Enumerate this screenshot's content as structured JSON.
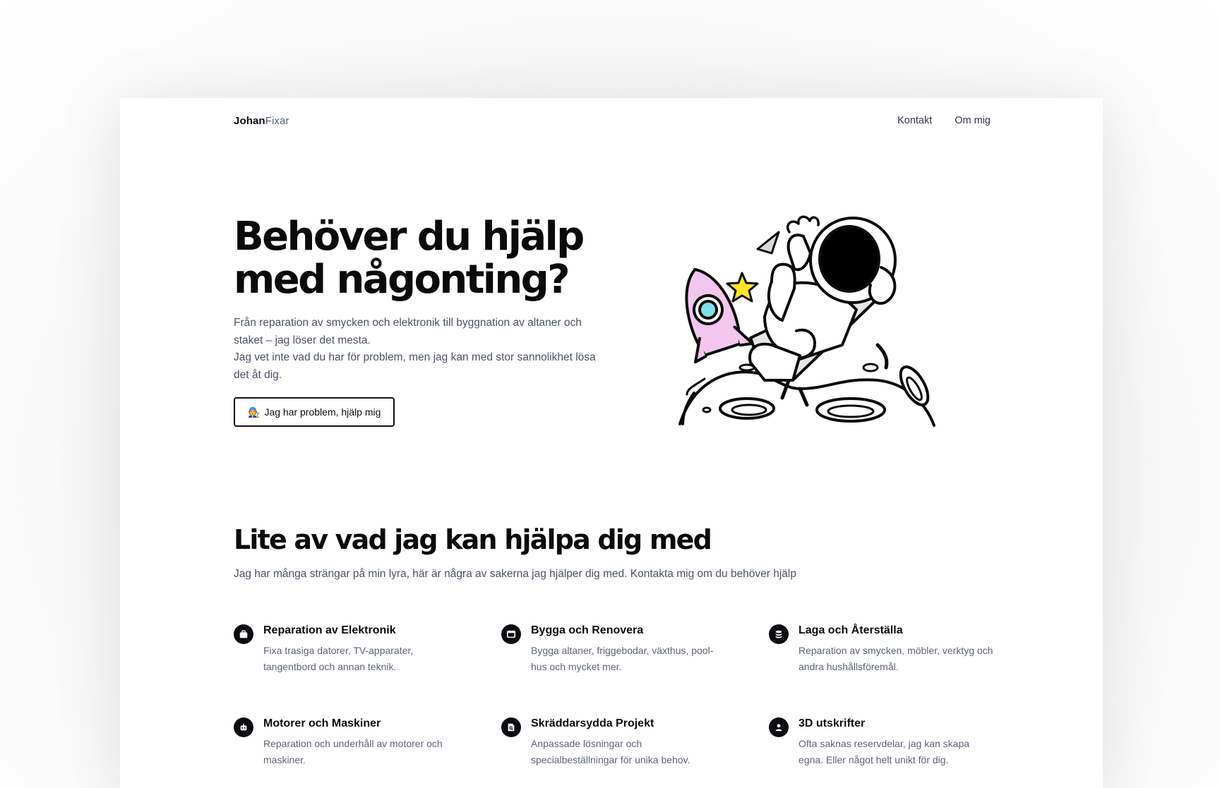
{
  "header": {
    "logo_part1": "Johan",
    "logo_part2": "Fixar",
    "nav": [
      "Kontakt",
      "Om mig"
    ]
  },
  "hero": {
    "title": "Behöver du hjälp med någonting?",
    "text_line1": "Från reparation av smycken och elektronik till byggnation av altaner och staket – jag löser det mesta.",
    "text_line2": "Jag vet inte vad du har för problem, men jag kan med stor sannolikhet lösa det åt dig.",
    "cta_emoji": "🧑‍🔧",
    "cta_label": "Jag har problem, hjälp mig"
  },
  "services": {
    "title": "Lite av vad jag kan hjälpa dig med",
    "subtitle": "Jag har många strängar på min lyra, här är några av sakerna jag hjälper dig med. Kontakta mig om du behöver hjälp",
    "items": [
      {
        "icon": "briefcase-icon",
        "title": "Reparation av Elektronik",
        "text": "Fixa trasiga datorer, TV-apparater, tangentbord och annan teknik."
      },
      {
        "icon": "window-icon",
        "title": "Bygga och Renovera",
        "text": "Bygga altaner, friggebodar, växthus, pool-hus och mycket mer."
      },
      {
        "icon": "database-icon",
        "title": "Laga och Återställa",
        "text": "Reparation av smycken, möbler, verktyg och andra hushållsföremål."
      },
      {
        "icon": "robot-icon",
        "title": "Motorer och Maskiner",
        "text": "Reparation och underhåll av motorer och maskiner."
      },
      {
        "icon": "document-search-icon",
        "title": "Skräddarsydda Projekt",
        "text": "Anpassade lösningar och specialbeställningar för unika behov."
      },
      {
        "icon": "user-icon",
        "title": "3D utskrifter",
        "text": "Ofta saknas reservdelar, jag kan skapa egna. Eller något helt unikt för dig."
      }
    ]
  },
  "colors": {
    "rocket_pink": "#f3c6ef",
    "rocket_window": "#7fe0e8",
    "star_yellow": "#ffe42b",
    "text_muted": "#4a5268"
  }
}
